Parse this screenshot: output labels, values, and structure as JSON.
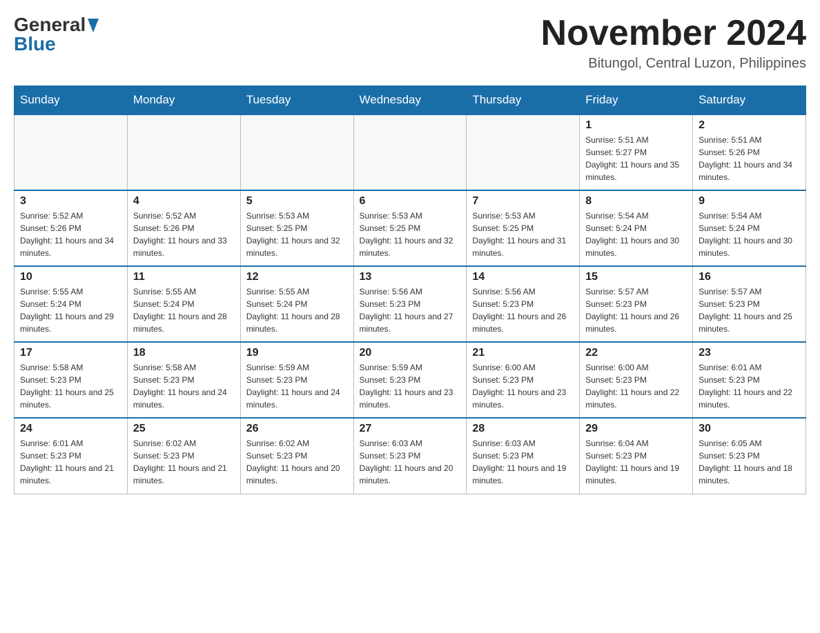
{
  "header": {
    "month_title": "November 2024",
    "location": "Bitungol, Central Luzon, Philippines",
    "logo_general": "General",
    "logo_blue": "Blue"
  },
  "days_of_week": [
    "Sunday",
    "Monday",
    "Tuesday",
    "Wednesday",
    "Thursday",
    "Friday",
    "Saturday"
  ],
  "weeks": [
    {
      "days": [
        {
          "number": "",
          "empty": true
        },
        {
          "number": "",
          "empty": true
        },
        {
          "number": "",
          "empty": true
        },
        {
          "number": "",
          "empty": true
        },
        {
          "number": "",
          "empty": true
        },
        {
          "number": "1",
          "sunrise": "5:51 AM",
          "sunset": "5:27 PM",
          "daylight": "11 hours and 35 minutes."
        },
        {
          "number": "2",
          "sunrise": "5:51 AM",
          "sunset": "5:26 PM",
          "daylight": "11 hours and 34 minutes."
        }
      ]
    },
    {
      "days": [
        {
          "number": "3",
          "sunrise": "5:52 AM",
          "sunset": "5:26 PM",
          "daylight": "11 hours and 34 minutes."
        },
        {
          "number": "4",
          "sunrise": "5:52 AM",
          "sunset": "5:26 PM",
          "daylight": "11 hours and 33 minutes."
        },
        {
          "number": "5",
          "sunrise": "5:53 AM",
          "sunset": "5:25 PM",
          "daylight": "11 hours and 32 minutes."
        },
        {
          "number": "6",
          "sunrise": "5:53 AM",
          "sunset": "5:25 PM",
          "daylight": "11 hours and 32 minutes."
        },
        {
          "number": "7",
          "sunrise": "5:53 AM",
          "sunset": "5:25 PM",
          "daylight": "11 hours and 31 minutes."
        },
        {
          "number": "8",
          "sunrise": "5:54 AM",
          "sunset": "5:24 PM",
          "daylight": "11 hours and 30 minutes."
        },
        {
          "number": "9",
          "sunrise": "5:54 AM",
          "sunset": "5:24 PM",
          "daylight": "11 hours and 30 minutes."
        }
      ]
    },
    {
      "days": [
        {
          "number": "10",
          "sunrise": "5:55 AM",
          "sunset": "5:24 PM",
          "daylight": "11 hours and 29 minutes."
        },
        {
          "number": "11",
          "sunrise": "5:55 AM",
          "sunset": "5:24 PM",
          "daylight": "11 hours and 28 minutes."
        },
        {
          "number": "12",
          "sunrise": "5:55 AM",
          "sunset": "5:24 PM",
          "daylight": "11 hours and 28 minutes."
        },
        {
          "number": "13",
          "sunrise": "5:56 AM",
          "sunset": "5:23 PM",
          "daylight": "11 hours and 27 minutes."
        },
        {
          "number": "14",
          "sunrise": "5:56 AM",
          "sunset": "5:23 PM",
          "daylight": "11 hours and 26 minutes."
        },
        {
          "number": "15",
          "sunrise": "5:57 AM",
          "sunset": "5:23 PM",
          "daylight": "11 hours and 26 minutes."
        },
        {
          "number": "16",
          "sunrise": "5:57 AM",
          "sunset": "5:23 PM",
          "daylight": "11 hours and 25 minutes."
        }
      ]
    },
    {
      "days": [
        {
          "number": "17",
          "sunrise": "5:58 AM",
          "sunset": "5:23 PM",
          "daylight": "11 hours and 25 minutes."
        },
        {
          "number": "18",
          "sunrise": "5:58 AM",
          "sunset": "5:23 PM",
          "daylight": "11 hours and 24 minutes."
        },
        {
          "number": "19",
          "sunrise": "5:59 AM",
          "sunset": "5:23 PM",
          "daylight": "11 hours and 24 minutes."
        },
        {
          "number": "20",
          "sunrise": "5:59 AM",
          "sunset": "5:23 PM",
          "daylight": "11 hours and 23 minutes."
        },
        {
          "number": "21",
          "sunrise": "6:00 AM",
          "sunset": "5:23 PM",
          "daylight": "11 hours and 23 minutes."
        },
        {
          "number": "22",
          "sunrise": "6:00 AM",
          "sunset": "5:23 PM",
          "daylight": "11 hours and 22 minutes."
        },
        {
          "number": "23",
          "sunrise": "6:01 AM",
          "sunset": "5:23 PM",
          "daylight": "11 hours and 22 minutes."
        }
      ]
    },
    {
      "days": [
        {
          "number": "24",
          "sunrise": "6:01 AM",
          "sunset": "5:23 PM",
          "daylight": "11 hours and 21 minutes."
        },
        {
          "number": "25",
          "sunrise": "6:02 AM",
          "sunset": "5:23 PM",
          "daylight": "11 hours and 21 minutes."
        },
        {
          "number": "26",
          "sunrise": "6:02 AM",
          "sunset": "5:23 PM",
          "daylight": "11 hours and 20 minutes."
        },
        {
          "number": "27",
          "sunrise": "6:03 AM",
          "sunset": "5:23 PM",
          "daylight": "11 hours and 20 minutes."
        },
        {
          "number": "28",
          "sunrise": "6:03 AM",
          "sunset": "5:23 PM",
          "daylight": "11 hours and 19 minutes."
        },
        {
          "number": "29",
          "sunrise": "6:04 AM",
          "sunset": "5:23 PM",
          "daylight": "11 hours and 19 minutes."
        },
        {
          "number": "30",
          "sunrise": "6:05 AM",
          "sunset": "5:23 PM",
          "daylight": "11 hours and 18 minutes."
        }
      ]
    }
  ],
  "labels": {
    "sunrise": "Sunrise:",
    "sunset": "Sunset:",
    "daylight": "Daylight:"
  }
}
